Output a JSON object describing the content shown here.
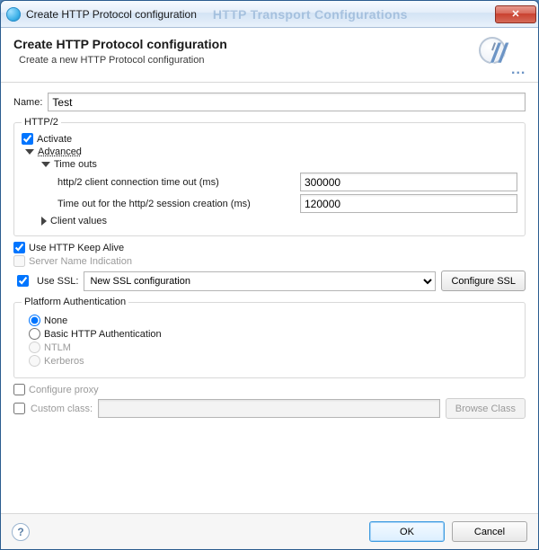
{
  "window": {
    "title": "Create HTTP Protocol configuration",
    "faded_title": "HTTP Transport Configurations",
    "close_glyph": "✕"
  },
  "header": {
    "title": "Create HTTP Protocol configuration",
    "subtitle": "Create a new HTTP Protocol configuration"
  },
  "name": {
    "label": "Name:",
    "value": "Test"
  },
  "http2": {
    "legend": "HTTP/2",
    "activate_label": "Activate",
    "activate_checked": true,
    "advanced_label": "Advanced",
    "timeouts_label": "Time outs",
    "conn_timeout_label": "http/2 client connection time out (ms)",
    "conn_timeout_value": "300000",
    "sess_timeout_label": "Time out for the http/2 session creation (ms)",
    "sess_timeout_value": "120000",
    "client_values_label": "Client values"
  },
  "opts": {
    "keepalive_label": "Use HTTP Keep Alive",
    "keepalive_checked": true,
    "sni_label": "Server Name Indication",
    "sni_enabled": false
  },
  "ssl": {
    "use_label": "Use SSL:",
    "use_checked": true,
    "selected": "New SSL configuration",
    "configure_label": "Configure SSL"
  },
  "auth": {
    "legend": "Platform Authentication",
    "none": "None",
    "basic": "Basic HTTP Authentication",
    "ntlm": "NTLM",
    "kerberos": "Kerberos",
    "selected": "none"
  },
  "proxy": {
    "label": "Configure proxy",
    "checked": false
  },
  "custom": {
    "label": "Custom class:",
    "checked": false,
    "value": "",
    "browse_label": "Browse Class"
  },
  "footer": {
    "ok": "OK",
    "cancel": "Cancel",
    "help": "?"
  }
}
